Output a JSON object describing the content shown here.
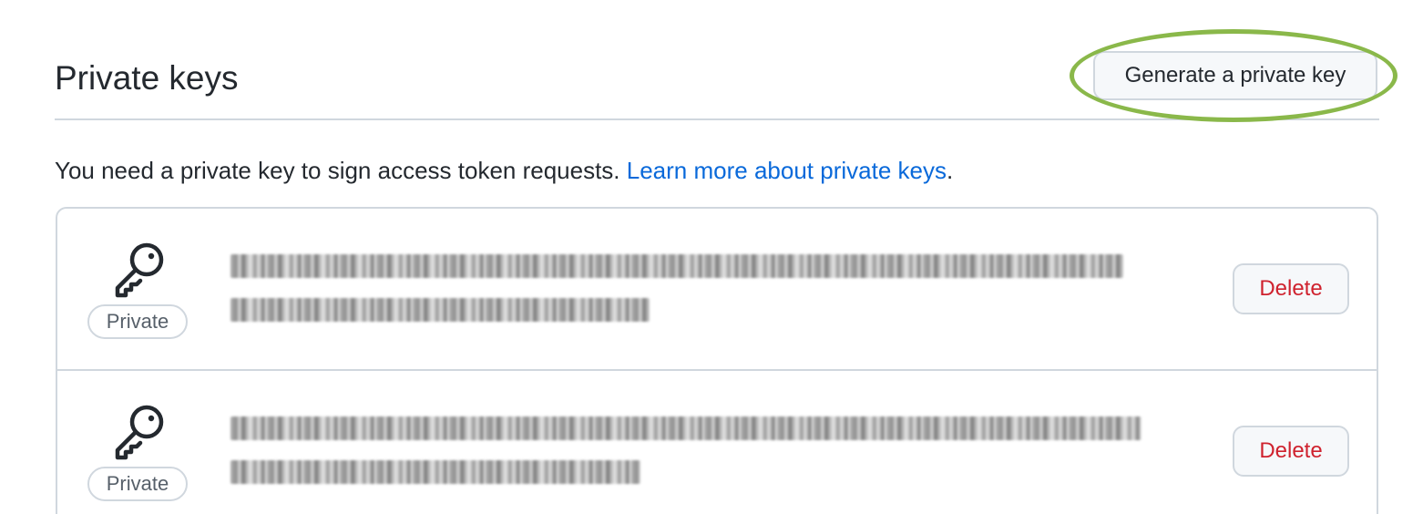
{
  "header": {
    "title": "Private keys",
    "generate_button": "Generate a private key"
  },
  "description": {
    "text": "You need a private key to sign access token requests. ",
    "link_text": "Learn more about private keys",
    "suffix": "."
  },
  "keys": [
    {
      "icon": "key-icon",
      "badge": "Private",
      "fingerprint_redacted": true,
      "delete_label": "Delete"
    },
    {
      "icon": "key-icon",
      "badge": "Private",
      "fingerprint_redacted": true,
      "delete_label": "Delete"
    }
  ],
  "colors": {
    "link": "#0969da",
    "danger": "#cf222e",
    "highlight": "#8ab84a",
    "border": "#d0d7de"
  }
}
